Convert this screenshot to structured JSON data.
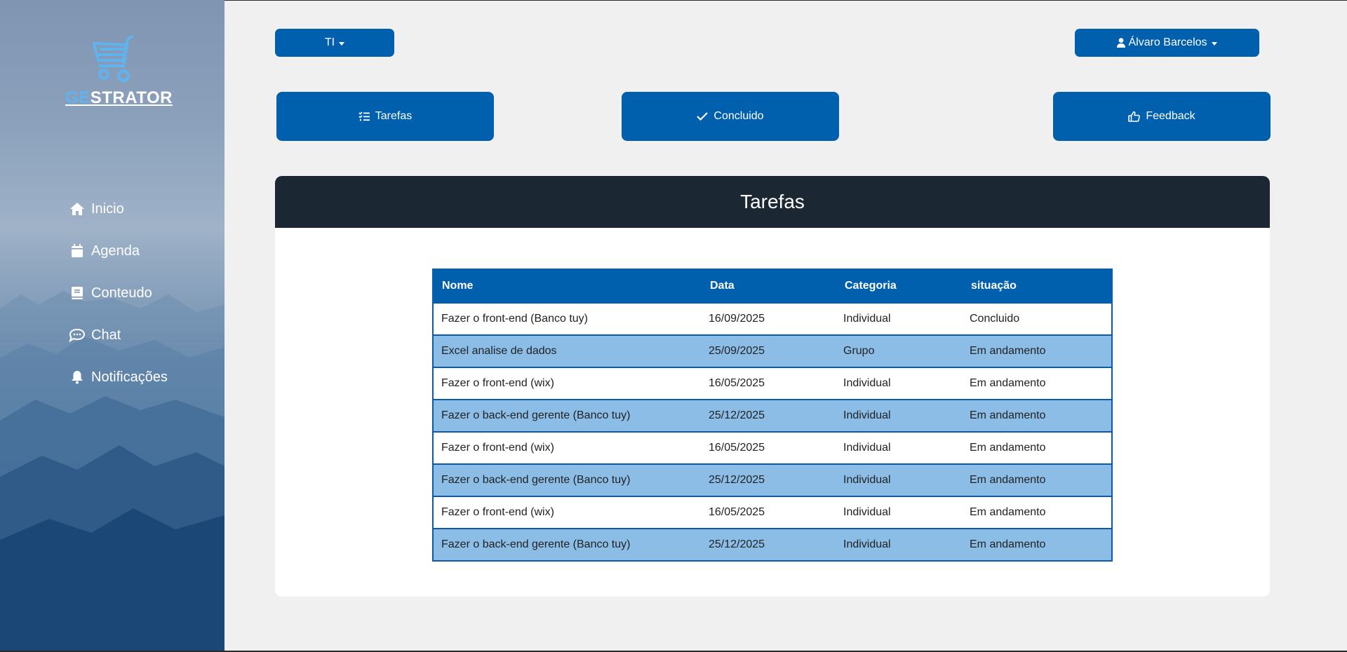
{
  "brand": {
    "logo_prefix": "GE",
    "logo_suffix": "STRATOR"
  },
  "sidebar": {
    "items": [
      {
        "label": "Inicio",
        "icon": "home-icon"
      },
      {
        "label": "Agenda",
        "icon": "calendar-icon"
      },
      {
        "label": "Conteudo",
        "icon": "book-icon"
      },
      {
        "label": "Chat",
        "icon": "chat-icon"
      },
      {
        "label": "Notificações",
        "icon": "bell-icon"
      }
    ]
  },
  "topbar": {
    "department": "TI",
    "user_name": "Álvaro Barcelos"
  },
  "actions": {
    "tarefas": "Tarefas",
    "concluido": "Concluido",
    "feedback": "Feedback"
  },
  "card": {
    "title": "Tarefas"
  },
  "table": {
    "headers": [
      "Nome",
      "Data",
      "Categoria",
      "situação"
    ],
    "rows": [
      [
        "Fazer o front-end (Banco tuy)",
        "16/09/2025",
        "Individual",
        "Concluido"
      ],
      [
        "Excel analise de dados",
        "25/09/2025",
        "Grupo",
        "Em andamento"
      ],
      [
        "Fazer o front-end (wix)",
        "16/05/2025",
        "Individual",
        "Em andamento"
      ],
      [
        "Fazer o back-end gerente (Banco tuy)",
        "25/12/2025",
        "Individual",
        "Em andamento"
      ],
      [
        "Fazer o front-end (wix)",
        "16/05/2025",
        "Individual",
        "Em andamento"
      ],
      [
        "Fazer o back-end gerente (Banco tuy)",
        "25/12/2025",
        "Individual",
        "Em andamento"
      ],
      [
        "Fazer o front-end (wix)",
        "16/05/2025",
        "Individual",
        "Em andamento"
      ],
      [
        "Fazer o back-end gerente (Banco tuy)",
        "25/12/2025",
        "Individual",
        "Em andamento"
      ]
    ]
  },
  "colors": {
    "primary": "#0060ad",
    "header_dark": "#1b2834",
    "row_alt": "#8bbde6",
    "logo_accent": "#5fb4ef"
  }
}
